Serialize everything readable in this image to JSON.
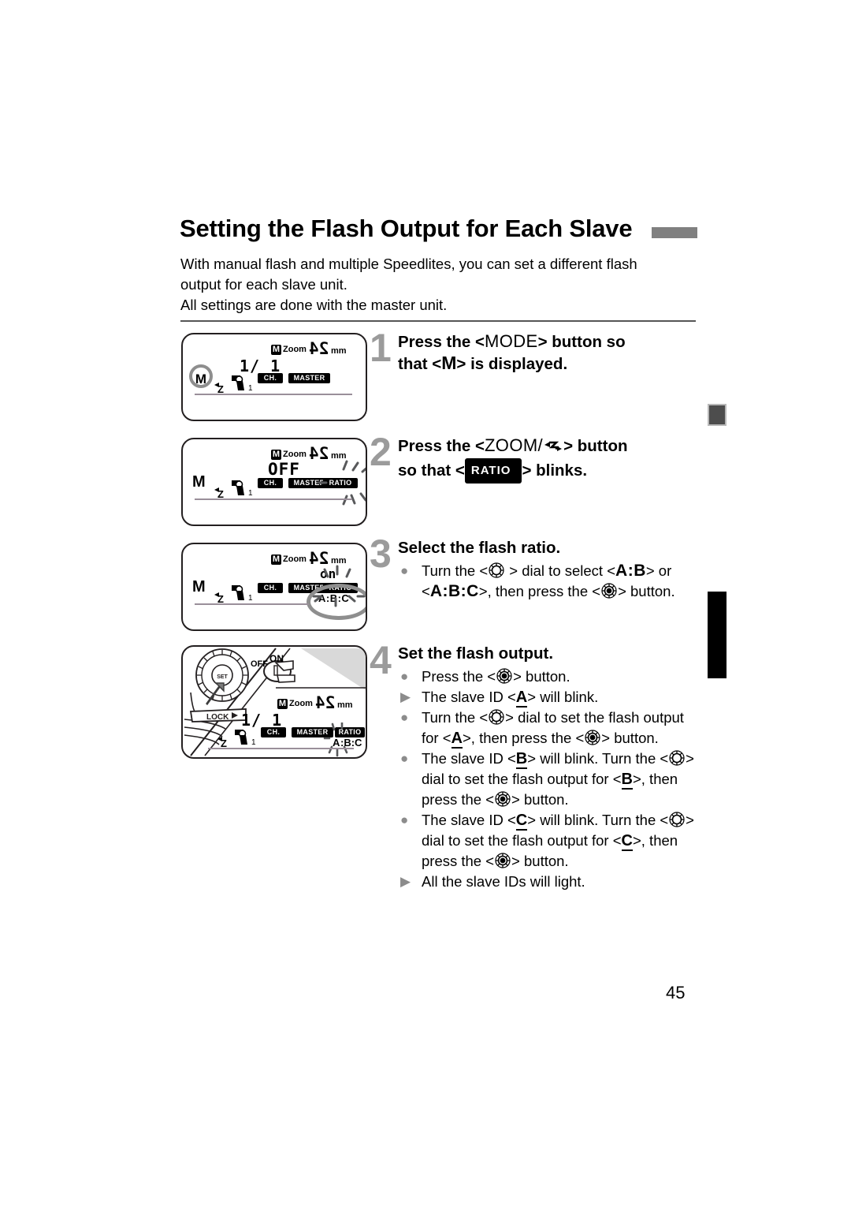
{
  "page": {
    "number": "45",
    "title": "Setting the Flash Output for Each Slave",
    "intro_line1": "With manual flash and multiple Speedlites, you can set a different flash",
    "intro_line2": "output for each slave unit.",
    "intro_line3": "All settings are done with the master unit."
  },
  "colors": {
    "title_bar": "#808080",
    "step_number": "#9b9b9b",
    "bullet_marker": "#8c8c8c",
    "margin_square": "#4d4d4d",
    "margin_bar": "#000000",
    "lcd_highlight_ring": "#8e8e8e",
    "badge_background": "#000000"
  },
  "steps": [
    {
      "number": "1",
      "heading_parts": [
        "Press the <",
        "MODE",
        "> button so"
      ],
      "heading_line2_parts": [
        "that <",
        "M",
        "> is displayed."
      ],
      "bullets": []
    },
    {
      "number": "2",
      "heading_parts": [
        "Press the <",
        "ZOOM/",
        "> button"
      ],
      "heading_line2_prefix": "so that <",
      "heading_badge": "RATIO",
      "heading_line2_suffix": "> blinks.",
      "bullets": []
    },
    {
      "number": "3",
      "heading": "Select the flash ratio.",
      "bullets": [
        {
          "marker": "dot",
          "segments": [
            {
              "t": "text",
              "v": "Turn the <"
            },
            {
              "t": "icon",
              "v": "dial-icon"
            },
            {
              "t": "text",
              "v": " > dial to select <"
            },
            {
              "t": "abc",
              "v": "A:B"
            },
            {
              "t": "text",
              "v": "> or <"
            },
            {
              "t": "abc",
              "v": "A:B:C"
            },
            {
              "t": "text",
              "v": ">, then press the <"
            },
            {
              "t": "icon",
              "v": "set-button-icon"
            },
            {
              "t": "text",
              "v": "> button."
            }
          ]
        }
      ]
    },
    {
      "number": "4",
      "heading": "Set the flash output.",
      "bullets": [
        {
          "marker": "dot",
          "segments": [
            {
              "t": "text",
              "v": "Press the <"
            },
            {
              "t": "icon",
              "v": "set-button-icon"
            },
            {
              "t": "text",
              "v": "> button."
            }
          ]
        },
        {
          "marker": "tri",
          "segments": [
            {
              "t": "text",
              "v": "The slave ID <"
            },
            {
              "t": "id",
              "v": "A"
            },
            {
              "t": "text",
              "v": "> will blink."
            }
          ]
        },
        {
          "marker": "dot",
          "segments": [
            {
              "t": "text",
              "v": "Turn the <"
            },
            {
              "t": "icon",
              "v": "dial-icon"
            },
            {
              "t": "text",
              "v": "> dial to set the flash output for <"
            },
            {
              "t": "id",
              "v": "A"
            },
            {
              "t": "text",
              "v": ">, then press the <"
            },
            {
              "t": "icon",
              "v": "set-button-icon"
            },
            {
              "t": "text",
              "v": "> button."
            }
          ]
        },
        {
          "marker": "dot",
          "segments": [
            {
              "t": "text",
              "v": "The slave ID <"
            },
            {
              "t": "id",
              "v": "B"
            },
            {
              "t": "text",
              "v": "> will blink. Turn the <"
            },
            {
              "t": "icon",
              "v": "dial-icon"
            },
            {
              "t": "text",
              "v": "> dial to set the flash output for <"
            },
            {
              "t": "id",
              "v": "B"
            },
            {
              "t": "text",
              "v": ">, then press the <"
            },
            {
              "t": "icon",
              "v": "set-button-icon"
            },
            {
              "t": "text",
              "v": "> button."
            }
          ]
        },
        {
          "marker": "dot",
          "segments": [
            {
              "t": "text",
              "v": "The slave ID <"
            },
            {
              "t": "id",
              "v": "C"
            },
            {
              "t": "text",
              "v": "> will blink. Turn the <"
            },
            {
              "t": "icon",
              "v": "dial-icon"
            },
            {
              "t": "text",
              "v": "> dial to set the flash output for <"
            },
            {
              "t": "id",
              "v": "C"
            },
            {
              "t": "text",
              "v": ">, then press the <"
            },
            {
              "t": "icon",
              "v": "set-button-icon"
            },
            {
              "t": "text",
              "v": "> button."
            }
          ]
        },
        {
          "marker": "tri",
          "segments": [
            {
              "t": "text",
              "v": "All the slave IDs will light."
            }
          ]
        }
      ]
    }
  ],
  "lcd_panels": [
    {
      "id": "panel-step-1",
      "mode_circle": "M",
      "zoom_m": "M",
      "zoom_label": "Zoom",
      "zoom_value": "24",
      "zoom_unit": "mm",
      "output": "1/ 1",
      "channel_badge": "CH.",
      "channel_number": "1",
      "master_badge": "MASTER",
      "ratio_badge": null,
      "abc": null,
      "blinking": []
    },
    {
      "id": "panel-step-2",
      "mode_plain": "M",
      "zoom_m": "M",
      "zoom_label": "Zoom",
      "zoom_value": "24",
      "zoom_unit": "mm",
      "output": "OFF",
      "channel_badge": "CH.",
      "channel_number": "1",
      "master_badge": "MASTER",
      "ratio_badge": "RATIO",
      "abc": null,
      "blinking": [
        "RATIO"
      ]
    },
    {
      "id": "panel-step-3",
      "mode_plain": "M",
      "zoom_m": "M",
      "zoom_label": "Zoom",
      "zoom_value": "24",
      "zoom_unit": "mm",
      "output": "on",
      "channel_badge": "CH.",
      "channel_number": "1",
      "master_badge": "MASTER",
      "ratio_badge": "RATIO",
      "abc": "A:B:C",
      "blinking": [
        "A:B:C"
      ]
    },
    {
      "id": "panel-step-4",
      "switch_off": "OFF",
      "switch_on": "ON",
      "lock_label": "LOCK",
      "dial_center": "SET",
      "zoom_m": "M",
      "zoom_label": "Zoom",
      "zoom_value": "24",
      "zoom_unit": "mm",
      "output": "1/ 1",
      "channel_badge": "CH.",
      "channel_number": "1",
      "master_badge": "MASTER",
      "ratio_badge": "RATIO",
      "abc_a": "A",
      "abc_rest": ":B:C",
      "blinking": [
        "A"
      ]
    }
  ]
}
